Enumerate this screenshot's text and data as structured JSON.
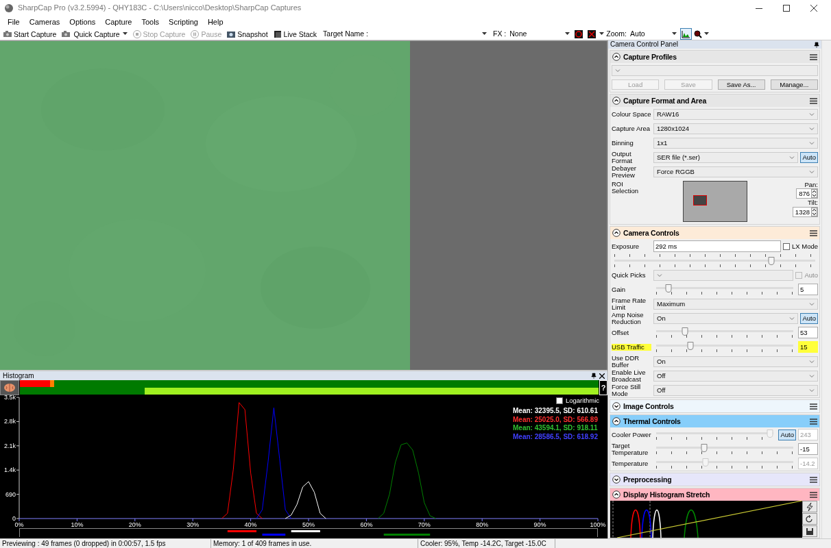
{
  "window": {
    "title": "SharpCap Pro (v3.2.5994) - QHY183C - C:\\Users\\nicco\\Desktop\\SharpCap Captures"
  },
  "menu": [
    "File",
    "Cameras",
    "Options",
    "Capture",
    "Tools",
    "Scripting",
    "Help"
  ],
  "toolbar": {
    "buttons": [
      {
        "label": "Start Capture",
        "disabled": false,
        "dropdown": false
      },
      {
        "label": "Quick Capture",
        "disabled": false,
        "dropdown": true
      },
      {
        "label": "Stop Capture",
        "disabled": true,
        "dropdown": false
      },
      {
        "label": "Pause",
        "disabled": true,
        "dropdown": false
      },
      {
        "label": "Snapshot",
        "disabled": false,
        "dropdown": false
      },
      {
        "label": "Live Stack",
        "disabled": false,
        "dropdown": false
      }
    ],
    "target_name": {
      "label": "Target Name :"
    },
    "fx": {
      "label": "FX :",
      "value": "None"
    },
    "zoom": {
      "label": "Zoom:",
      "value": "Auto"
    },
    "histogram_toggle": {
      "pressed": true
    }
  },
  "histogram": {
    "title": "Histogram",
    "help": "?",
    "logarithmic": {
      "label": "Logarithmic",
      "checked": false
    },
    "stats": [
      {
        "text": "Mean: 32395.5, SD: 610.61",
        "color": "#ffffff"
      },
      {
        "text": "Mean: 25025.0, SD: 566.89",
        "color": "#ff3030"
      },
      {
        "text": "Mean: 43594.1, SD: 918.11",
        "color": "#30c030"
      },
      {
        "text": "Mean: 28586.5, SD: 618.92",
        "color": "#4040ff"
      }
    ],
    "chart_data": {
      "type": "line",
      "x": [
        35,
        36,
        37,
        38,
        39,
        40,
        41,
        42,
        43,
        44,
        45,
        46,
        47,
        48,
        49,
        50,
        51,
        52,
        53,
        62,
        63,
        64,
        65,
        66,
        67,
        68,
        69,
        70,
        71,
        72
      ],
      "series": [
        {
          "color": "#ff0000",
          "values": [
            0,
            150,
            1400,
            3300,
            3100,
            1300,
            150,
            0,
            null,
            null,
            null,
            null,
            null,
            null,
            null,
            null,
            null,
            null,
            null,
            null,
            null,
            null,
            null,
            null,
            null,
            null,
            null,
            null,
            null,
            null
          ]
        },
        {
          "color": "#0000ff",
          "values": [
            null,
            null,
            null,
            null,
            null,
            null,
            0,
            250,
            1600,
            3150,
            1700,
            250,
            0,
            null,
            null,
            null,
            null,
            null,
            null,
            null,
            null,
            null,
            null,
            null,
            null,
            null,
            null,
            null,
            null,
            null
          ]
        },
        {
          "color": "#ffffff",
          "values": [
            null,
            null,
            null,
            null,
            null,
            null,
            null,
            null,
            null,
            null,
            null,
            0,
            100,
            400,
            900,
            1050,
            750,
            150,
            0,
            null,
            null,
            null,
            null,
            null,
            null,
            null,
            null,
            null,
            null,
            null
          ]
        },
        {
          "color": "#008000",
          "values": [
            null,
            null,
            null,
            null,
            null,
            null,
            null,
            null,
            null,
            null,
            null,
            null,
            null,
            null,
            null,
            null,
            null,
            null,
            null,
            0,
            150,
            700,
            1600,
            2100,
            2150,
            1950,
            1300,
            450,
            80,
            0
          ]
        }
      ],
      "xlim": [
        0,
        100
      ],
      "ylim": [
        0,
        3450
      ],
      "xticks": [
        {
          "value": 0,
          "label": "0%"
        },
        {
          "value": 10,
          "label": "10%"
        },
        {
          "value": 20,
          "label": "20%"
        },
        {
          "value": 30,
          "label": "30%"
        },
        {
          "value": 40,
          "label": "40%"
        },
        {
          "value": 50,
          "label": "50%"
        },
        {
          "value": 60,
          "label": "60%"
        },
        {
          "value": 70,
          "label": "70%"
        },
        {
          "value": 80,
          "label": "80%"
        },
        {
          "value": 90,
          "label": "90%"
        },
        {
          "value": 100,
          "label": "100%"
        }
      ],
      "yticks": [
        {
          "value": 0,
          "label": "0"
        },
        {
          "value": 690,
          "label": "690"
        },
        {
          "value": 1380,
          "label": "1.4k"
        },
        {
          "value": 2070,
          "label": "2.1k"
        },
        {
          "value": 2760,
          "label": "2.8k"
        },
        {
          "value": 3450,
          "label": "3.5k"
        }
      ]
    }
  },
  "panel": {
    "title": "Camera Control Panel",
    "sections": [
      {
        "title": "Capture Profiles",
        "expanded": true,
        "color": "#e6e6e6",
        "rows": [
          {
            "kind": "select"
          },
          {
            "kind": "buttons",
            "buttons": [
              {
                "label": "Load",
                "disabled": true
              },
              {
                "label": "Save",
                "disabled": true
              },
              {
                "label": "Save As...",
                "disabled": false
              },
              {
                "label": "Manage...",
                "disabled": false
              }
            ]
          }
        ]
      },
      {
        "title": "Capture Format and Area",
        "expanded": true,
        "color": "#e6e6e6",
        "rows": [
          {
            "kind": "select",
            "label": "Colour Space",
            "value": "RAW16"
          },
          {
            "kind": "select",
            "label": "Capture Area",
            "value": "1280x1024"
          },
          {
            "kind": "select",
            "label": "Binning",
            "value": "1x1"
          },
          {
            "kind": "select",
            "label": "Output Format",
            "value": "SER file (*.ser)",
            "auto": {
              "label": "Auto",
              "pressed": true
            }
          },
          {
            "kind": "select",
            "label": "Debayer Preview",
            "value": "Force RGGB"
          },
          {
            "kind": "roi",
            "label": "ROI Selection",
            "pan_label": "Pan:",
            "pan": "876",
            "tilt_label": "Tilt:",
            "tilt": "1328"
          }
        ]
      },
      {
        "title": "Camera Controls",
        "expanded": true,
        "color": "#fdebd8",
        "rows": [
          {
            "kind": "text",
            "label": "Exposure",
            "value": "292 ms",
            "checkbox": {
              "label": "LX Mode",
              "checked": false,
              "disabled": false
            }
          },
          {
            "kind": "slider",
            "level": 0.78
          },
          {
            "kind": "select",
            "label": "Quick Picks",
            "checkbox": {
              "label": "Auto",
              "checked": false,
              "disabled": true
            }
          },
          {
            "kind": "slider",
            "label": "Gain",
            "level": 0.09,
            "value": "5"
          },
          {
            "kind": "select",
            "label": "Frame Rate Limit",
            "value": "Maximum"
          },
          {
            "kind": "select",
            "label": "Amp Noise Reduction",
            "value": "On",
            "auto": {
              "label": "Auto",
              "pressed": true
            }
          },
          {
            "kind": "slider",
            "label": "Offset",
            "level": 0.21,
            "value": "53"
          },
          {
            "kind": "slider",
            "label": "USB Traffic",
            "level": 0.25,
            "value": "15",
            "highlighted": true
          },
          {
            "kind": "select",
            "label": "Use DDR Buffer",
            "value": "On"
          },
          {
            "kind": "select",
            "label": "Enable Live Broadcast",
            "value": "Off"
          },
          {
            "kind": "select",
            "label": "Force Still Mode",
            "value": "Off"
          }
        ]
      },
      {
        "title": "Image Controls",
        "expanded": false,
        "color": "#eef6fc"
      },
      {
        "title": "Thermal Controls",
        "expanded": true,
        "color": "#87cefa",
        "rows": [
          {
            "kind": "slider",
            "label": "Cooler Power",
            "level": 0.97,
            "value": "243",
            "disabled": true,
            "auto": {
              "label": "Auto",
              "pressed": true
            }
          },
          {
            "kind": "slider",
            "label": "Target Temperature",
            "level": 0.35,
            "value": "-15"
          },
          {
            "kind": "slider",
            "label": "Temperature",
            "level": 0.36,
            "value": "-14.2",
            "disabled": true
          }
        ]
      },
      {
        "title": "Preprocessing",
        "expanded": false,
        "color": "#e6e6fa"
      },
      {
        "title": "Display Histogram Stretch",
        "expanded": true,
        "color": "#ffb6c1",
        "rows": [
          {
            "kind": "stretch"
          }
        ]
      }
    ]
  },
  "status_bar": [
    "Previewing : 49 frames (0 dropped) in 0:00:57, 1.5 fps",
    "Memory: 1 of 409 frames in use.",
    "Cooler: 95%, Temp -14.2C, Target -15.0C"
  ]
}
